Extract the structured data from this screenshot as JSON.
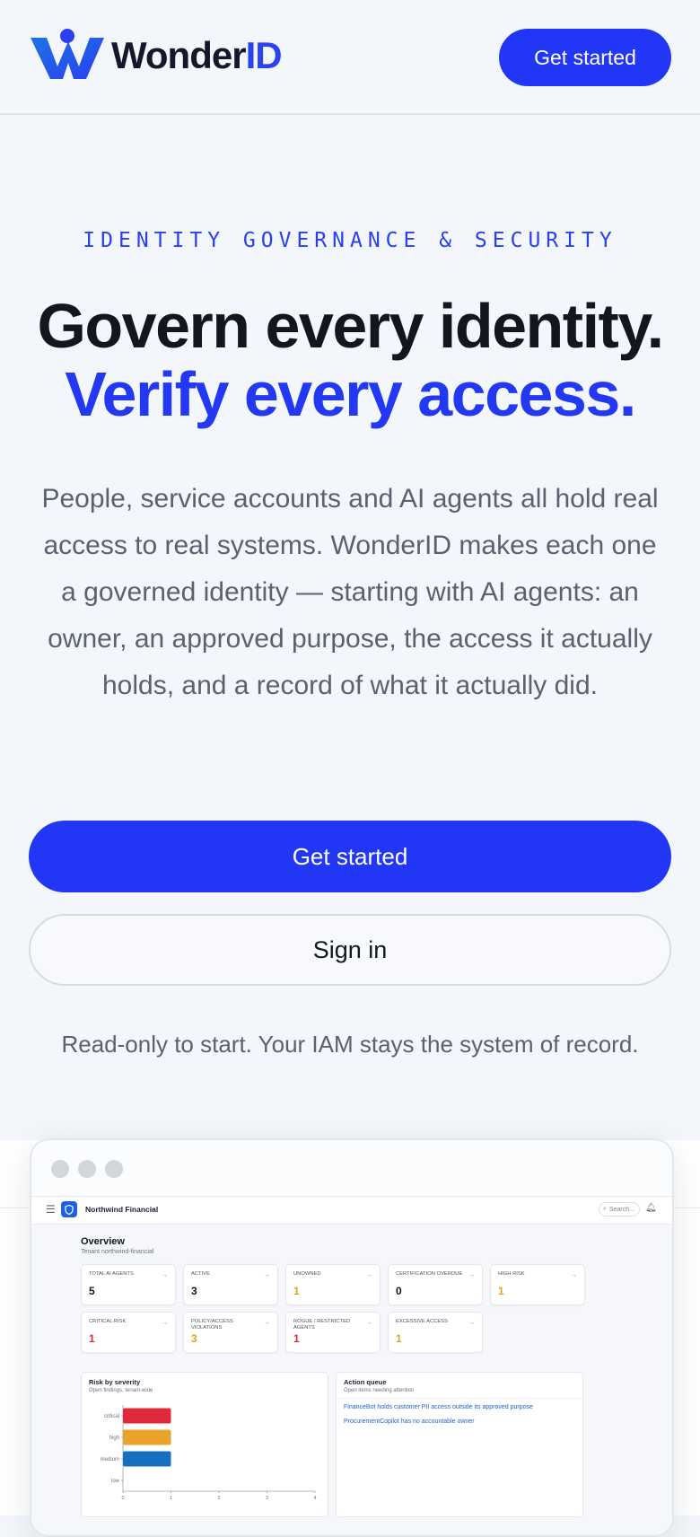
{
  "header": {
    "brand_prefix": "Wonder",
    "brand_suffix": "ID",
    "cta_label": "Get started"
  },
  "hero": {
    "eyebrow": "IDENTITY GOVERNANCE & SECURITY",
    "headline_line1": "Govern every identity.",
    "headline_line2": "Verify every access.",
    "lead": "People, service accounts and AI agents all hold real access to real systems. WonderID makes each one a governed identity — starting with AI agents: an owner, an approved purpose, the access it actually holds, and a record of what it actually did.",
    "primary_cta": "Get started",
    "secondary_cta": "Sign in",
    "note": "Read-only to start. Your IAM stays the system of record."
  },
  "preview": {
    "topbar": {
      "tenant": "Northwind Financial",
      "search_placeholder": "Search..."
    },
    "overview": {
      "title": "Overview",
      "subtitle": "Tenant northwind-financial"
    },
    "kpis": [
      {
        "label": "TOTAL AI AGENTS",
        "value": "5",
        "color": "#12161f"
      },
      {
        "label": "ACTIVE",
        "value": "3",
        "color": "#12161f"
      },
      {
        "label": "UNOWNED",
        "value": "1",
        "color": "#e0a022"
      },
      {
        "label": "CERTIFICATION OVERDUE",
        "value": "0",
        "color": "#12161f"
      },
      {
        "label": "HIGH RISK",
        "value": "1",
        "color": "#e0a022"
      },
      {
        "label": "CRITICAL RISK",
        "value": "1",
        "color": "#d92c3a"
      },
      {
        "label": "POLICY/ACCESS VIOLATIONS",
        "value": "3",
        "color": "#e0a022"
      },
      {
        "label": "ROGUE / RESTRICTED AGENTS",
        "value": "1",
        "color": "#d92c3a"
      },
      {
        "label": "EXCESSIVE ACCESS",
        "value": "1",
        "color": "#e0a022"
      }
    ],
    "risk_panel": {
      "title": "Risk by severity",
      "subtitle": "Open findings, tenant-wide"
    },
    "action_panel": {
      "title": "Action queue",
      "subtitle": "Open items needing attention",
      "items": [
        "FinanceBot holds customer PII access outside its approved purpose",
        "ProcurementCopilot has no accountable owner"
      ]
    }
  },
  "chart_data": {
    "type": "bar",
    "orientation": "horizontal",
    "categories": [
      "critical",
      "high",
      "medium",
      "low"
    ],
    "values": [
      1,
      1,
      1,
      0
    ],
    "colors": [
      "#e02a3c",
      "#e9a32a",
      "#1670c0",
      "#9aa3b0"
    ],
    "xlim": [
      0,
      4
    ],
    "xticks": [
      "0",
      "1",
      "2",
      "3",
      "4"
    ]
  }
}
